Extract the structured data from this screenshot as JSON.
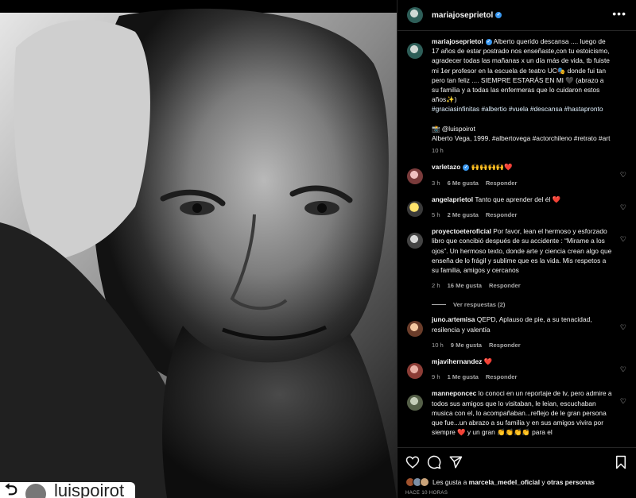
{
  "post": {
    "author": "mariajoseprietol",
    "caption": "Alberto querido descansa .... luego de 17 años de estar postrado nos enseñaste,con tu estoicismo, agradecer todas las mañanas x un día más de vida, tb fuiste mi 1er profesor en la escuela de teatro UC🎭 donde fui tan pero tan feliz .... SIEMPRE ESTARÁS EN MI 🖤 (abrazo a su familia y a todas las enfermeras que lo cuidaron estos años✨)",
    "hashtags": "#graciasinfinitas #albertio #vuela #descansa #hastapronto",
    "photo_credit": "📸 @luispoirot",
    "photo_info": "Alberto Vega, 1999. #albertovega #actorchileno #retrato #art",
    "time": "10 h"
  },
  "repost": {
    "icon": "repost-icon",
    "name": "luispoirot"
  },
  "comments": [
    {
      "user": "varletazo",
      "verified": true,
      "text": "🙌🙌🙌🙌❤️",
      "time": "3 h",
      "likes": "6 Me gusta",
      "reply": "Responder"
    },
    {
      "user": "angelaprietol",
      "verified": false,
      "text": "Tanto que aprender del él ❤️",
      "time": "5 h",
      "likes": "2 Me gusta",
      "reply": "Responder"
    },
    {
      "user": "proyectoeteroficial",
      "verified": false,
      "text": "Por favor, lean el hermoso y esforzado libro que concibió después de su accidente : “Mirame a los ojos”. Un hermoso texto, donde arte y ciencia crean algo que enseña de lo frágil y sublime que es la vida. Mis respetos a su familia, amigos y cercanos",
      "time": "2 h",
      "likes": "16 Me gusta",
      "reply": "Responder",
      "replies": "Ver respuestas (2)"
    },
    {
      "user": "juno.artemisa",
      "verified": false,
      "text": "QEPD, Aplauso de pie, a su tenacidad, resilencia y valentía",
      "time": "10 h",
      "likes": "9 Me gusta",
      "reply": "Responder"
    },
    {
      "user": "mjavihernandez",
      "verified": false,
      "text": "❤️",
      "time": "9 h",
      "likes": "1 Me gusta",
      "reply": "Responder"
    },
    {
      "user": "manneponcec",
      "verified": false,
      "text": "lo conoci en un reportaje de tv, pero admire a todos sus amigos que lo visitaban, le leian, escuchaban musica con el, lo acompañaban...reflejo de le gran persona que fue...un abrazo a su familia y en sus amigos vivira por siempre ❤️ y un gran 👏👏👏👏 para el",
      "time": "",
      "likes": "",
      "reply": ""
    }
  ],
  "likes_line": {
    "prefix": "Les gusta a",
    "user": "marcela_medel_oficial",
    "joiner": "y",
    "others": "otras personas"
  },
  "time_ago": "HACE 10 HORAS",
  "icons": {
    "more": "more-options-icon",
    "heart": "heart-icon",
    "comment": "comment-icon",
    "share": "share-icon",
    "save": "bookmark-icon",
    "verified": "verified-badge-icon"
  }
}
